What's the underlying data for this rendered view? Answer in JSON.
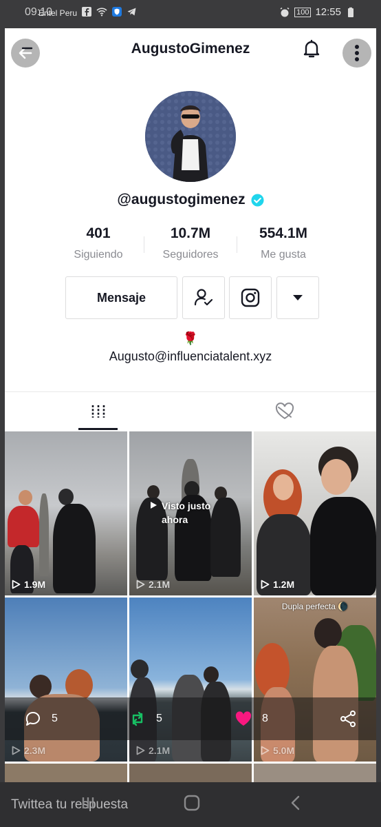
{
  "status_bar": {
    "time": "09:10",
    "carrier": "Entel Peru",
    "battery": "100",
    "clock_right": "12:55"
  },
  "header": {
    "title": "AugustoGimenez"
  },
  "profile": {
    "handle": "@augustogimenez",
    "verified": true,
    "stats": [
      {
        "value": "401",
        "label": "Siguiendo"
      },
      {
        "value": "10.7M",
        "label": "Seguidores"
      },
      {
        "value": "554.1M",
        "label": "Me gusta"
      }
    ],
    "buttons": {
      "message": "Mensaje"
    },
    "bio_emoji": "🌹",
    "bio_link": "Augusto@influenciatalent.xyz"
  },
  "tabs": {
    "active": "videos-tab",
    "items": [
      "videos-grid-icon",
      "liked-hidden-icon"
    ]
  },
  "videos": [
    {
      "views": "1.9M"
    },
    {
      "views": "2.1M",
      "watched_label": "Visto justo ahora"
    },
    {
      "views": "1.2M"
    },
    {
      "views": "2.3M"
    },
    {
      "views": "2.1M"
    },
    {
      "views": "5.0M",
      "caption": "Dupla perfecta 🌘"
    }
  ],
  "tweet_actions": {
    "replies": "5",
    "retweets": "5",
    "likes": "8"
  },
  "reply_box": {
    "placeholder": "Twittea tu respuesta"
  },
  "colors": {
    "verified": "#20d5ec",
    "retweet": "#17bf63",
    "like": "#f91880",
    "text": "#161823",
    "muted": "#8a8b91"
  }
}
